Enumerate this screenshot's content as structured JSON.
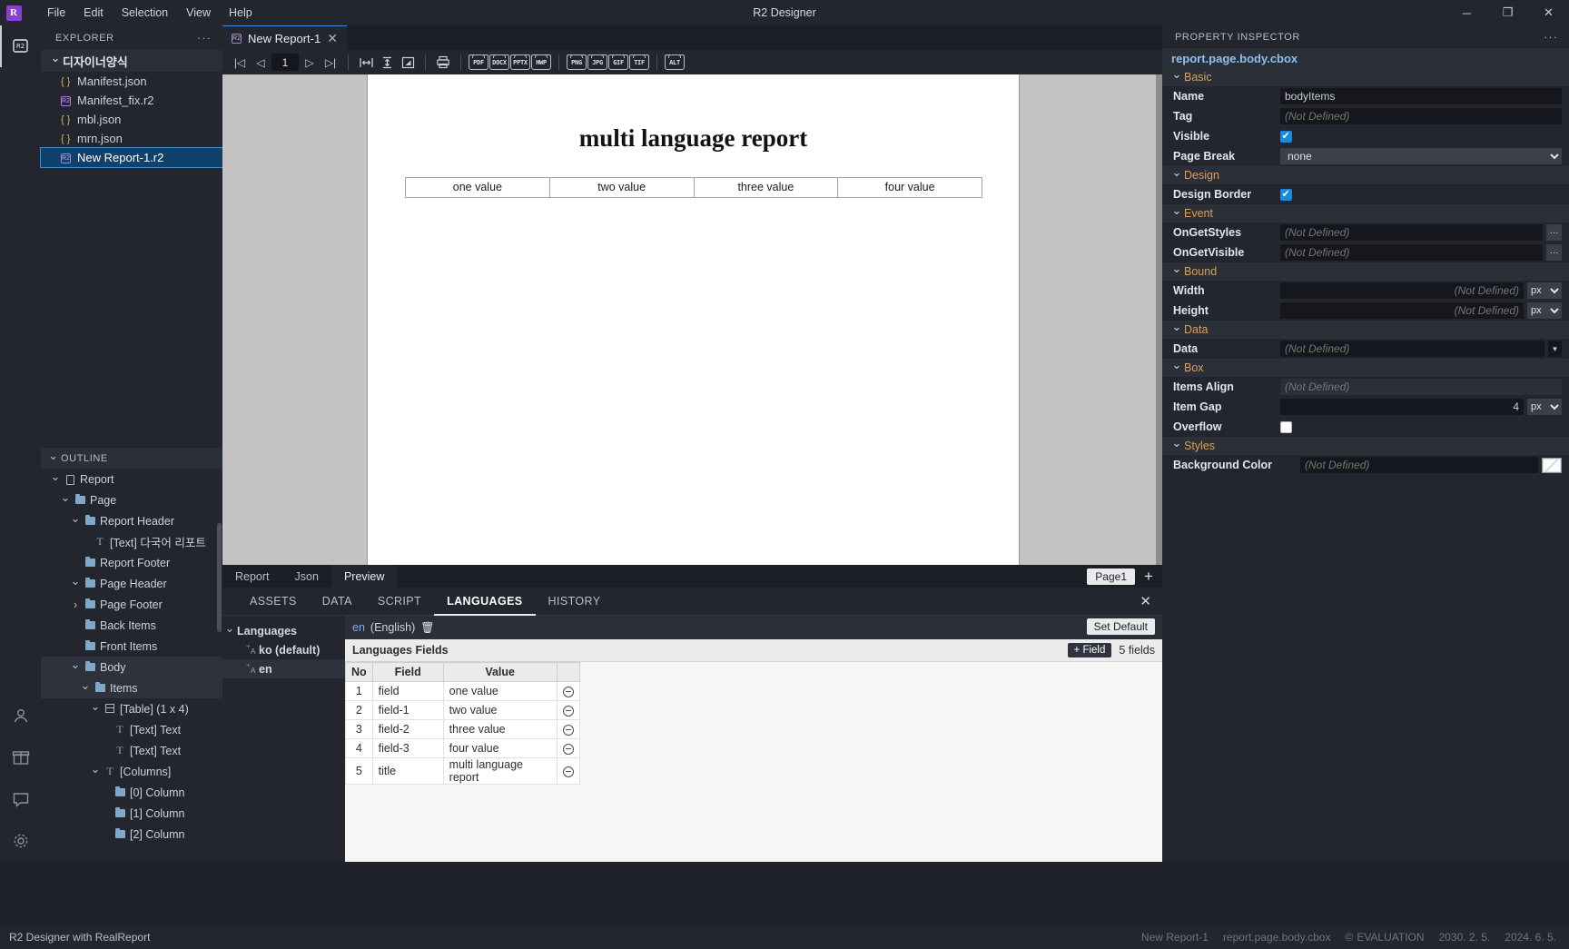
{
  "window": {
    "title": "R2 Designer",
    "logo": "R",
    "controls": {
      "minimize": "─",
      "maximize": "❐",
      "close": "✕"
    }
  },
  "menubar": {
    "items": [
      "File",
      "Edit",
      "Selection",
      "View",
      "Help"
    ]
  },
  "activitybar": {
    "items": [
      {
        "name": "r2-explorer-icon",
        "glyph": "R2"
      },
      {
        "name": "package-icon",
        "glyph": "▤"
      },
      {
        "name": "account-icon",
        "glyph": "○"
      },
      {
        "name": "gift-icon",
        "glyph": "▦"
      },
      {
        "name": "feedback-icon",
        "glyph": "▭"
      },
      {
        "name": "gear-icon",
        "glyph": "⚙"
      }
    ]
  },
  "explorer": {
    "header": "EXPLORER",
    "more": "···",
    "root": "디자이너양식",
    "files": [
      {
        "name": "Manifest.json",
        "type": "json",
        "selected": false
      },
      {
        "name": "Manifest_fix.r2",
        "type": "r2",
        "selected": false
      },
      {
        "name": "mbl.json",
        "type": "json",
        "selected": false
      },
      {
        "name": "mrn.json",
        "type": "json",
        "selected": false
      },
      {
        "name": "New Report-1.r2",
        "type": "r2",
        "selected": true
      }
    ]
  },
  "outline": {
    "header": "OUTLINE",
    "nodes": [
      {
        "label": "Report",
        "depth": 0,
        "icon": "doc",
        "chev": "down",
        "sel": false
      },
      {
        "label": "Page",
        "depth": 1,
        "icon": "folder",
        "chev": "down",
        "sel": false
      },
      {
        "label": "Report Header",
        "depth": 2,
        "icon": "folder",
        "chev": "down",
        "sel": false
      },
      {
        "label": "[Text] 다국어 리포트",
        "depth": 3,
        "icon": "text",
        "chev": "none",
        "sel": false
      },
      {
        "label": "Report Footer",
        "depth": 2,
        "icon": "folder",
        "chev": "none",
        "sel": false
      },
      {
        "label": "Page Header",
        "depth": 2,
        "icon": "folder",
        "chev": "down",
        "sel": false
      },
      {
        "label": "Page Footer",
        "depth": 2,
        "icon": "folder",
        "chev": "right",
        "sel": false
      },
      {
        "label": "Back Items",
        "depth": 2,
        "icon": "folder",
        "chev": "none",
        "sel": false
      },
      {
        "label": "Front Items",
        "depth": 2,
        "icon": "folder",
        "chev": "none",
        "sel": false
      },
      {
        "label": "Body",
        "depth": 2,
        "icon": "folder",
        "chev": "down",
        "sel": true
      },
      {
        "label": "Items",
        "depth": 3,
        "icon": "folder",
        "chev": "down",
        "sel": true
      },
      {
        "label": "[Table] (1 x 4)",
        "depth": 4,
        "icon": "table",
        "chev": "down",
        "sel": false
      },
      {
        "label": "[Text] Text",
        "depth": 5,
        "icon": "text",
        "chev": "none",
        "sel": false
      },
      {
        "label": "[Text] Text",
        "depth": 5,
        "icon": "text",
        "chev": "none",
        "sel": false
      },
      {
        "label": "[Columns]",
        "depth": 4,
        "icon": "text",
        "chev": "down",
        "sel": false
      },
      {
        "label": "[0] Column",
        "depth": 5,
        "icon": "folder",
        "chev": "none",
        "sel": false
      },
      {
        "label": "[1] Column",
        "depth": 5,
        "icon": "folder",
        "chev": "none",
        "sel": false
      },
      {
        "label": "[2] Column",
        "depth": 5,
        "icon": "folder",
        "chev": "none",
        "sel": false
      }
    ]
  },
  "editor": {
    "tab": {
      "label": "New Report-1",
      "close": "✕"
    },
    "toolbar": {
      "first_page": "|◁",
      "prev_page": "◁",
      "page_value": "1",
      "next_page": "▷",
      "last_page": "▷|",
      "fit_width": "|↔|",
      "fit_height": "↕",
      "fit_page": "⤡",
      "print": "⎙",
      "exports": [
        "PDF",
        "DOCX",
        "PPTX",
        "HWP"
      ],
      "images": [
        "PNG",
        "JPG",
        "GIF",
        "TIF",
        "TIF"
      ],
      "alt": "ALT"
    }
  },
  "report": {
    "title": "multi language report",
    "table_cells": [
      "one value",
      "two value",
      "three value",
      "four value"
    ]
  },
  "dock": {
    "tabs": [
      {
        "label": "Report",
        "active": false
      },
      {
        "label": "Json",
        "active": false
      },
      {
        "label": "Preview",
        "active": true
      }
    ],
    "page_chip": "Page1",
    "add": "+"
  },
  "panel": {
    "tabs": [
      {
        "label": "ASSETS",
        "active": false
      },
      {
        "label": "DATA",
        "active": false
      },
      {
        "label": "SCRIPT",
        "active": false
      },
      {
        "label": "LANGUAGES",
        "active": true
      },
      {
        "label": "HISTORY",
        "active": false
      }
    ],
    "close": "✕",
    "tree": {
      "root": "Languages",
      "items": [
        {
          "label": "ko (default)",
          "selected": false
        },
        {
          "label": "en",
          "selected": true
        }
      ]
    },
    "lang_header": {
      "code": "en",
      "name": "(English)",
      "delete": "🗑",
      "set_default": "Set Default"
    },
    "fields": {
      "title": "Languages Fields",
      "add_button": "+ Field",
      "count": "5 fields",
      "columns": [
        "No",
        "Field",
        "Value",
        ""
      ],
      "rows": [
        {
          "no": "1",
          "field": "field",
          "value": "one value"
        },
        {
          "no": "2",
          "field": "field-1",
          "value": "two value"
        },
        {
          "no": "3",
          "field": "field-2",
          "value": "three value"
        },
        {
          "no": "4",
          "field": "field-3",
          "value": "four value"
        },
        {
          "no": "5",
          "field": "title",
          "value": "multi language report"
        }
      ]
    }
  },
  "inspector": {
    "header": "PROPERTY INSPECTOR",
    "more": "···",
    "path": "report.page.body.cbox",
    "groups": {
      "basic": "Basic",
      "design": "Design",
      "event": "Event",
      "bound": "Bound",
      "data": "Data",
      "box": "Box",
      "styles": "Styles"
    },
    "labels": {
      "name": "Name",
      "tag": "Tag",
      "visible": "Visible",
      "page_break": "Page Break",
      "design_border": "Design Border",
      "on_get_styles": "OnGetStyles",
      "on_get_visible": "OnGetVisible",
      "width": "Width",
      "height": "Height",
      "data": "Data",
      "items_align": "Items Align",
      "item_gap": "Item Gap",
      "overflow": "Overflow",
      "background_color": "Background Color"
    },
    "values": {
      "name": "bodyItems",
      "tag": "(Not Defined)",
      "visible": true,
      "page_break": "none",
      "design_border": true,
      "on_get_styles": "(Not Defined)",
      "on_get_visible": "(Not Defined)",
      "width": "(Not Defined)",
      "width_unit": "px",
      "height": "(Not Defined)",
      "height_unit": "px",
      "data": "(Not Defined)",
      "items_align": "(Not Defined)",
      "item_gap": "4",
      "item_gap_unit": "px",
      "overflow": false,
      "background_color": "(Not Defined)"
    },
    "dots": "···"
  },
  "statusbar": {
    "left": "R2 Designer with RealReport",
    "file": "New Report-1",
    "path": "report.page.body.cbox",
    "evaluation": "EVALUATION",
    "date1": "2030. 2. 5.",
    "date2": "2024. 6. 5."
  }
}
